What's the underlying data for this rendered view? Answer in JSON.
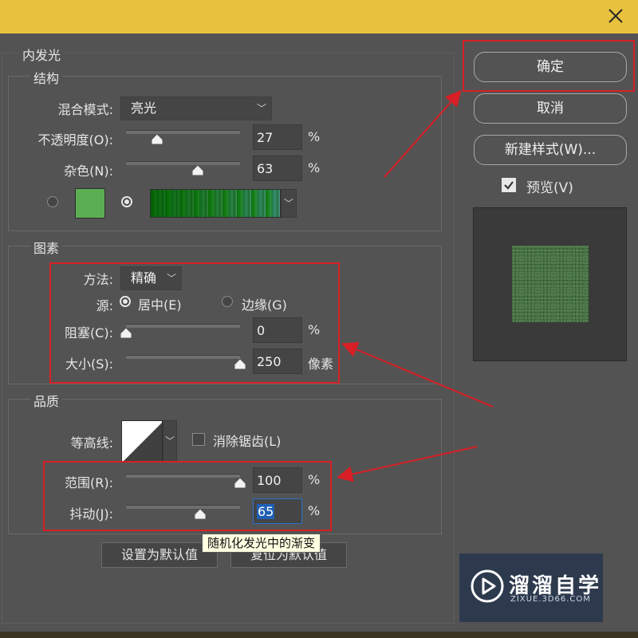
{
  "colors": {
    "titlebar": "#e8c13e",
    "panel_bg": "#535353",
    "highlight_red": "#d81f26",
    "swatch_green": "#5cae53",
    "selection_blue": "#1f5fb4",
    "tooltip_bg": "#ffffe1"
  },
  "window": {
    "close_icon": "close-icon"
  },
  "inner_glow": {
    "title": "内发光",
    "structure": {
      "title": "结构",
      "blend_mode": {
        "label": "混合模式:",
        "value": "亮光"
      },
      "opacity": {
        "label": "不透明度(O):",
        "value": "27",
        "unit": "%",
        "level": 0.27
      },
      "noise": {
        "label": "杂色(N):",
        "value": "63",
        "unit": "%",
        "level": 0.63
      }
    },
    "elements": {
      "title": "图素",
      "technique": {
        "label": "方法:",
        "value": "精确"
      },
      "source": {
        "label": "源:",
        "center": "居中(E)",
        "edge": "边缘(G)",
        "selected": "center"
      },
      "choke": {
        "label": "阻塞(C):",
        "value": "0",
        "unit": "%",
        "level": 0
      },
      "size": {
        "label": "大小(S):",
        "value": "250",
        "unit": "像素",
        "level": 1.0
      }
    },
    "quality": {
      "title": "品质",
      "contour": {
        "label": "等高线:"
      },
      "anti_alias": {
        "label": "消除锯齿(L)",
        "checked": false
      },
      "range": {
        "label": "范围(R):",
        "value": "100",
        "unit": "%",
        "level": 1.0
      },
      "jitter": {
        "label": "抖动(J):",
        "value": "65",
        "unit": "%",
        "level": 0.65
      }
    },
    "tooltip": "随机化发光中的渐变",
    "make_default": "设置为默认值",
    "reset_default": "复位为默认值"
  },
  "side": {
    "ok": "确定",
    "cancel": "取消",
    "new_style": "新建样式(W)...",
    "preview": {
      "label": "预览(V)",
      "checked": true
    }
  },
  "watermark": {
    "title": "溜溜自学",
    "sub": "ZIXUE.3D66.COM"
  }
}
